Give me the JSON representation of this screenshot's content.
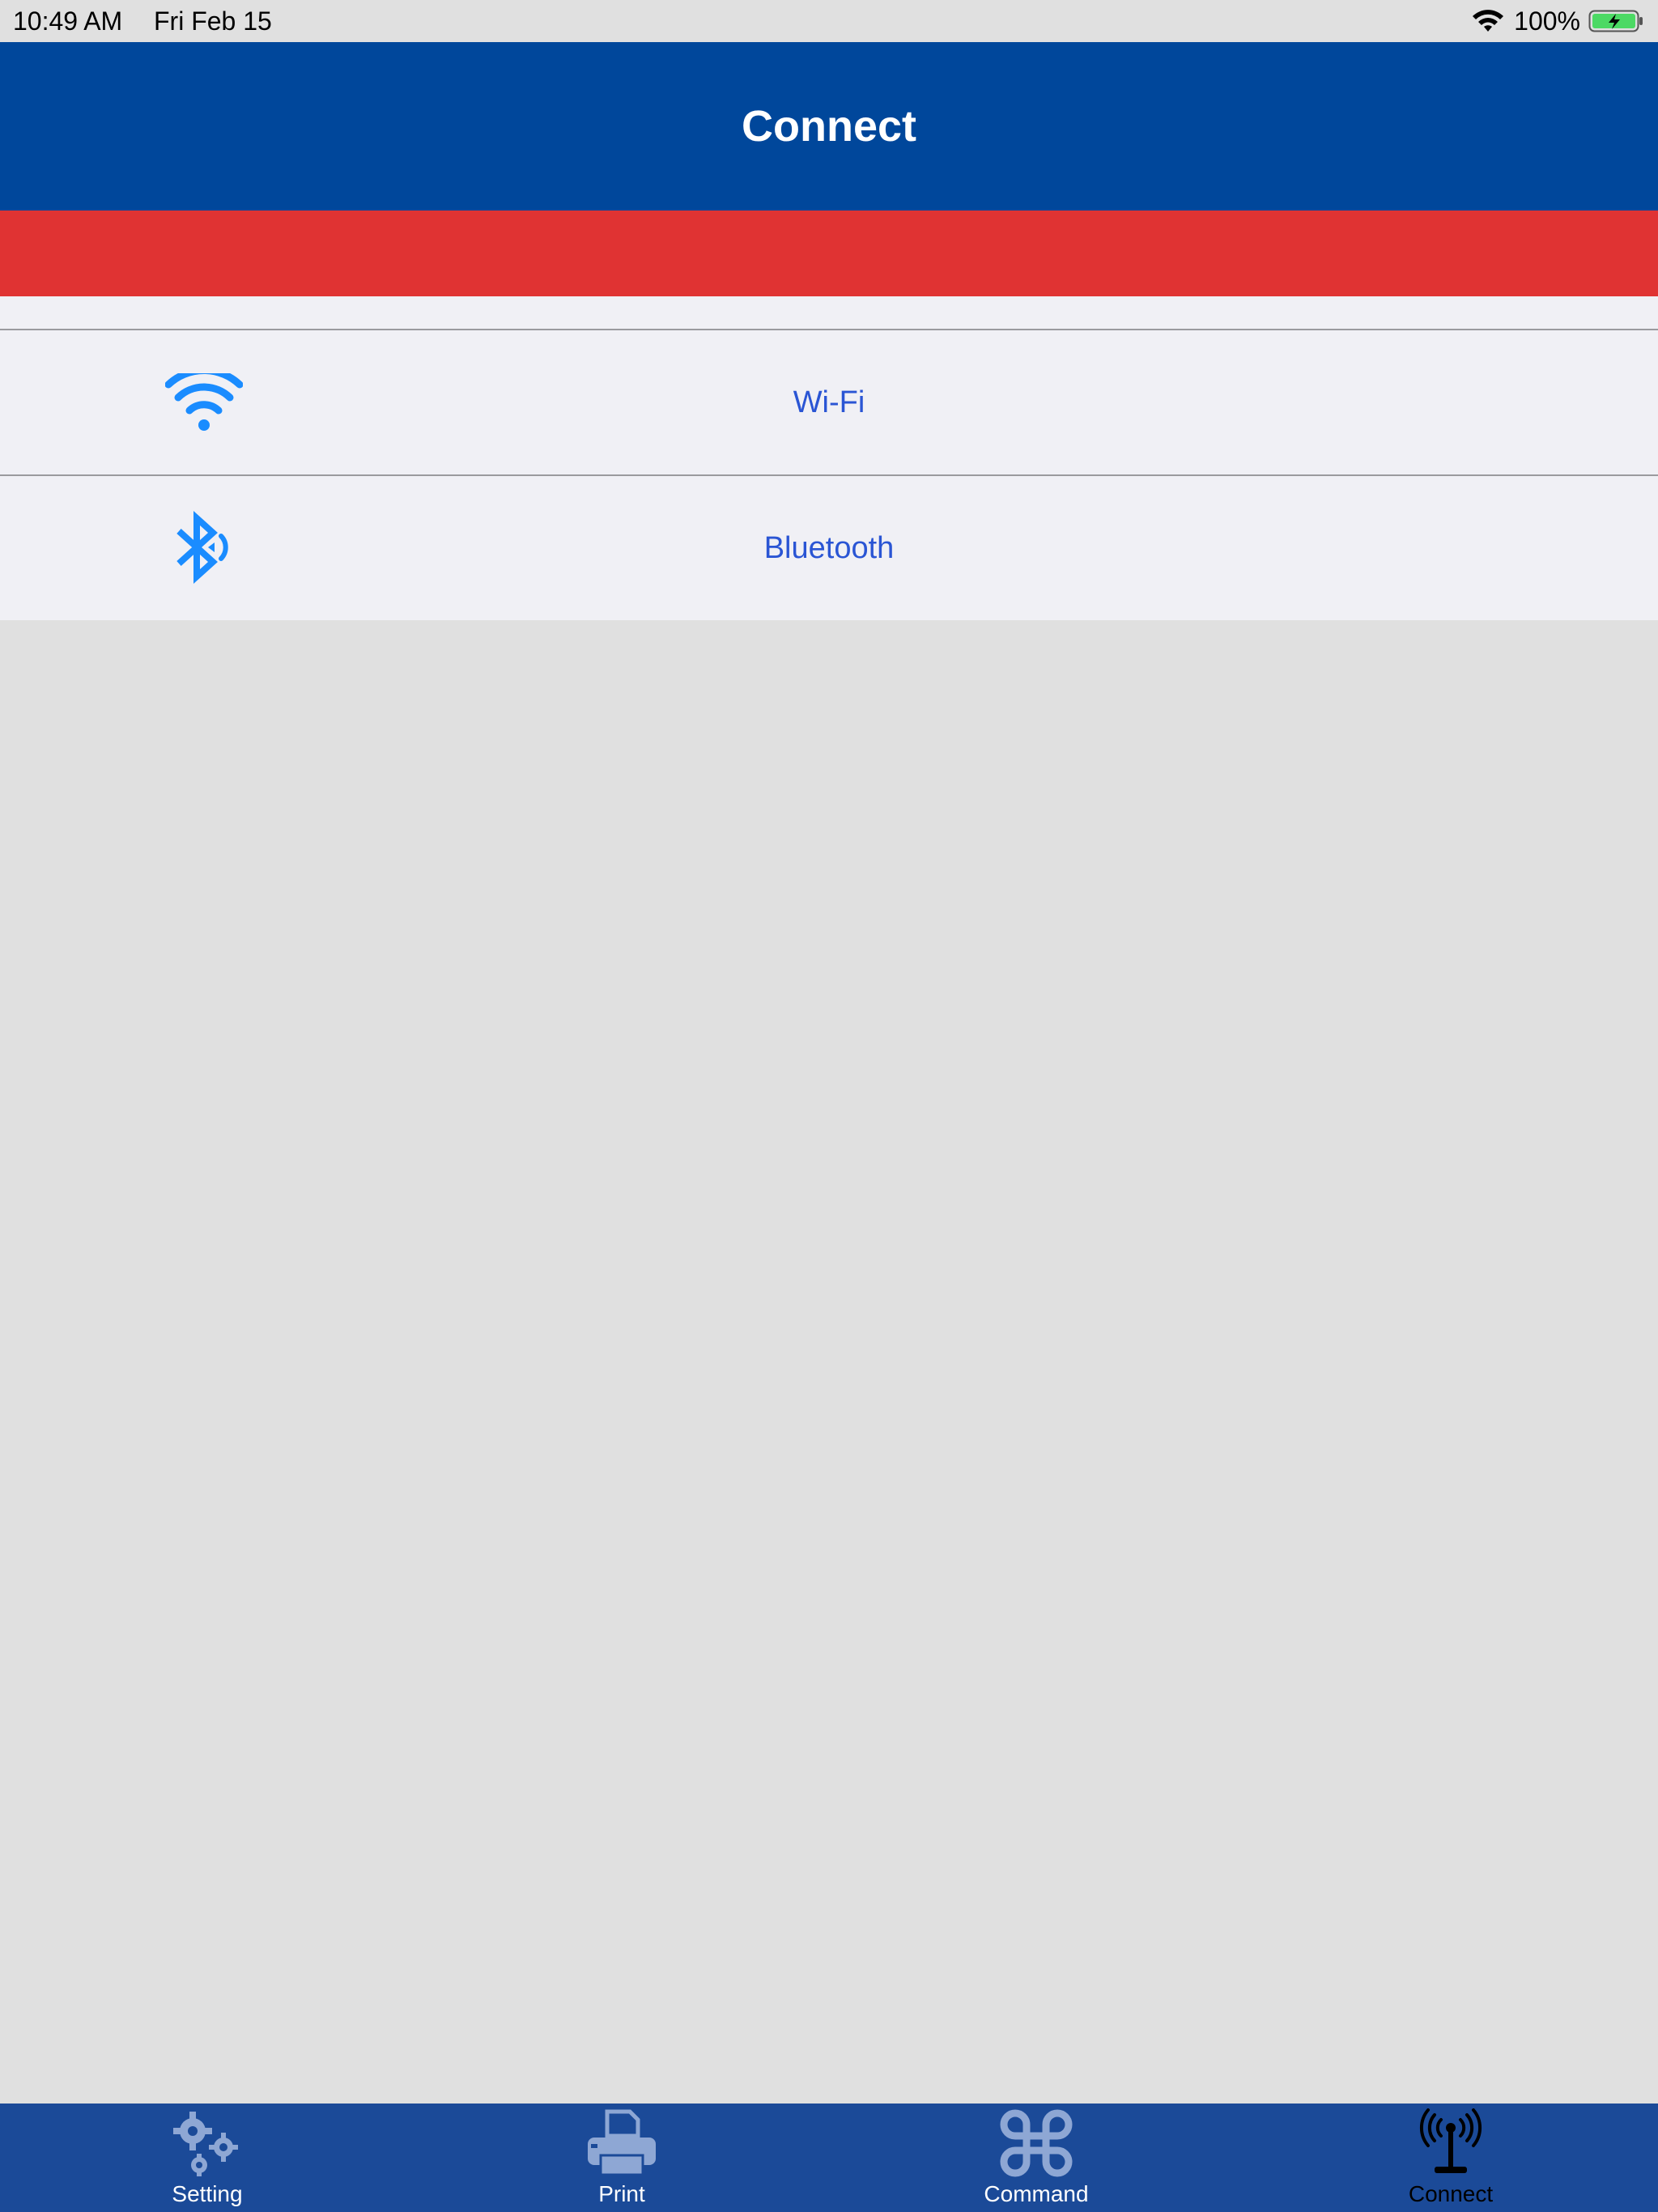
{
  "status_bar": {
    "time": "10:49 AM",
    "date": "Fri Feb 15",
    "battery_percent": "100%",
    "battery_level": 1.0,
    "wifi_icon": "wifi-icon",
    "battery_icon": "battery-charging-icon"
  },
  "nav": {
    "title": "Connect"
  },
  "colors": {
    "nav_background": "#00479b",
    "banner_red": "#e03333",
    "list_background": "#f0f0f5",
    "page_background": "#e0e0e0",
    "row_label": "#2a55d4",
    "row_icon": "#1a8cff",
    "tab_bar_background": "#1b4a98",
    "tab_icon_inactive": "#8ea7d4",
    "tab_icon_active": "#000000"
  },
  "connection_list": {
    "items": [
      {
        "label": "Wi-Fi",
        "icon": "wifi-icon"
      },
      {
        "label": "Bluetooth",
        "icon": "bluetooth-icon"
      }
    ]
  },
  "tab_bar": {
    "tabs": [
      {
        "label": "Setting",
        "icon": "gears-icon",
        "active": false
      },
      {
        "label": "Print",
        "icon": "printer-icon",
        "active": false
      },
      {
        "label": "Command",
        "icon": "command-icon",
        "active": false
      },
      {
        "label": "Connect",
        "icon": "antenna-icon",
        "active": true
      }
    ]
  }
}
